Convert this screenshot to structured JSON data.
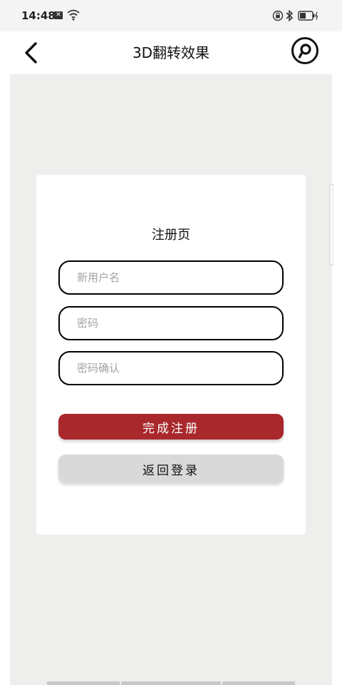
{
  "status_bar": {
    "time": "14:48",
    "notification_glyph": "✕",
    "icons": [
      "notification-icon",
      "wifi-icon",
      "rotation-lock-icon",
      "bluetooth-icon",
      "battery-icon"
    ]
  },
  "app_bar": {
    "title": "3D翻转效果",
    "back_icon": "chevron-left-icon",
    "logo_icon": "app-logo-icon"
  },
  "card": {
    "title": "注册页",
    "fields": [
      {
        "placeholder": "新用户名",
        "value": ""
      },
      {
        "placeholder": "密码",
        "value": ""
      },
      {
        "placeholder": "密码确认",
        "value": ""
      }
    ],
    "register_label": "完成注册",
    "back_to_login_label": "返回登录"
  },
  "colors": {
    "primary_button": "#a8282c",
    "secondary_button": "#d9d9d9",
    "background": "#eeeeed",
    "card": "#ffffff"
  }
}
